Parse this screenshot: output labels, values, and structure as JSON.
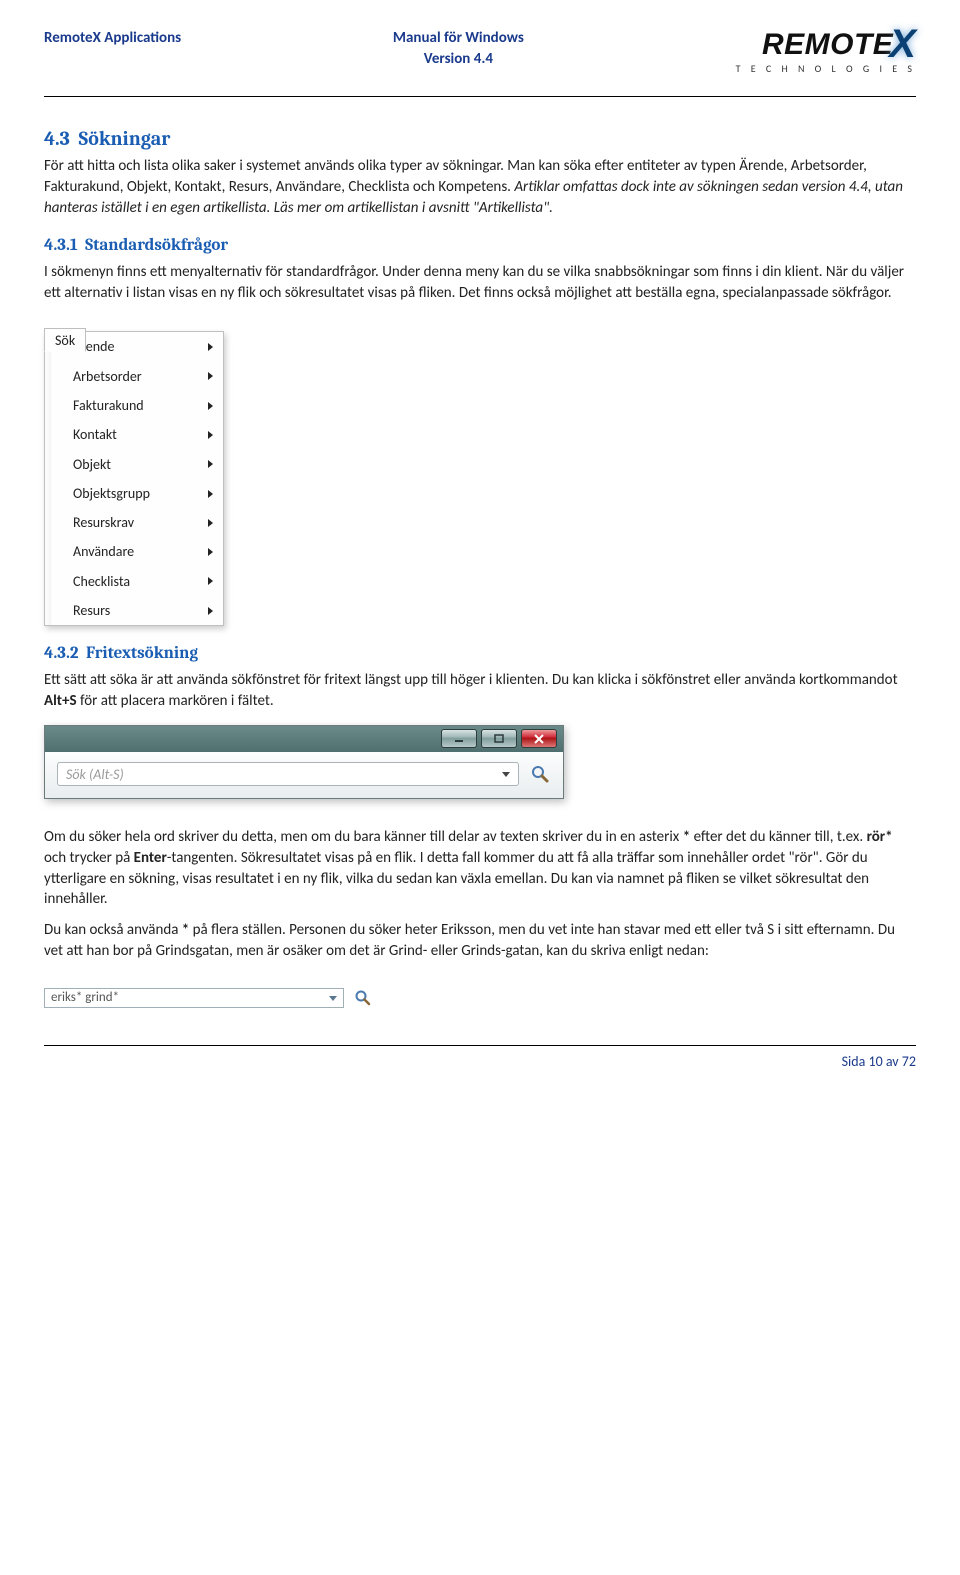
{
  "header": {
    "left": "RemoteX Applications",
    "center_line1": "Manual för Windows",
    "center_line2": "Version 4.4",
    "logo_name": "REMOTE",
    "logo_sub": "T E C H N O L O G I E S"
  },
  "section": {
    "num": "4.3",
    "title": "Sökningar",
    "para1_a": "För att hitta och lista olika saker i systemet används olika typer av sökningar. Man kan söka efter entiteter av typen Ärende, Arbetsorder, Fakturakund, Objekt, Kontakt, Resurs, Användare, Checklista och Kompetens. ",
    "para1_b_italic": "Artiklar omfattas dock inte av sökningen sedan version 4.4, utan hanteras istället i en egen artikellista. Läs mer om artikellistan i avsnitt \"Artikellista\"."
  },
  "subsection1": {
    "num": "4.3.1",
    "title": "Standardsökfrågor",
    "para": "I sökmenyn finns ett menyalternativ för standardfrågor. Under denna meny kan du se vilka snabbsökningar som finns i din klient. När du väljer ett alternativ i listan visas en ny flik och sökresultatet visas på fliken. Det finns också möjlighet att beställa egna, specialanpassade sökfrågor."
  },
  "menu": {
    "tab": "Sök",
    "items": [
      "Ärende",
      "Arbetsorder",
      "Fakturakund",
      "Kontakt",
      "Objekt",
      "Objektsgrupp",
      "Resurskrav",
      "Användare",
      "Checklista",
      "Resurs"
    ]
  },
  "subsection2": {
    "num": "4.3.2",
    "title": "Fritextsökning",
    "para1_a": "Ett sätt att söka är att använda sökfönstret för fritext längst upp till höger i klienten. Du kan klicka i sökfönstret eller använda kortkommandot ",
    "para1_b_bold": "Alt+S",
    "para1_c": " för att placera markören i fältet."
  },
  "window": {
    "placeholder": "Sök  (Alt-S)"
  },
  "para3_a": "Om du söker hela ord skriver du detta, men om du bara känner till delar av texten skriver du in en asterix ",
  "para3_bold1": "*",
  "para3_b": " efter det du känner till, t.ex. ",
  "para3_bold2": "rör*",
  "para3_c": " och trycker på ",
  "para3_bold3": "Enter",
  "para3_d": "-tangenten. Sökresultatet visas på en flik. I detta fall kommer du att få alla träffar som innehåller ordet \"rör\". Gör du ytterligare en sökning, visas resultatet i en ny flik, vilka du sedan kan växla emellan. Du kan via namnet på fliken se vilket sökresultat den innehåller.",
  "para4_a": "Du kan också använda ",
  "para4_bold": "*",
  "para4_b": " på flera ställen. Personen du söker heter Eriksson, men du vet inte han stavar med ett eller två S i sitt efternamn. Du vet att han bor på Grindsgatan, men är osäker om det är Grind- eller Grinds-gatan, kan du skriva enligt nedan:",
  "small_search_value": "eriks* grind*",
  "footer": "Sida 10 av 72"
}
